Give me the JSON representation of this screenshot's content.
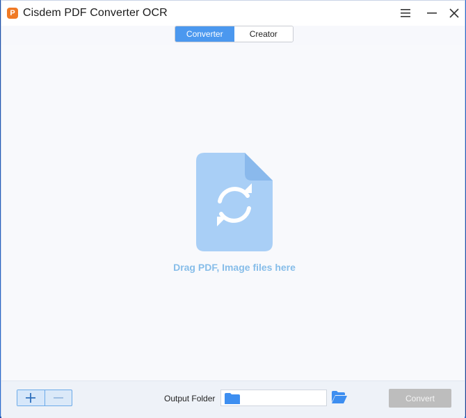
{
  "window": {
    "title": "Cisdem PDF Converter OCR"
  },
  "tabs": [
    {
      "label": "Converter",
      "active": true
    },
    {
      "label": "Creator",
      "active": false
    }
  ],
  "dropzone": {
    "hint": "Drag PDF, Image files here",
    "icon": "file-convert-icon"
  },
  "bottom": {
    "output_label": "Output Folder",
    "output_path": "",
    "convert_label": "Convert"
  },
  "colors": {
    "accent": "#4b98ef",
    "hint_text": "#86bde9",
    "disabled_button": "#bdbdbd"
  }
}
